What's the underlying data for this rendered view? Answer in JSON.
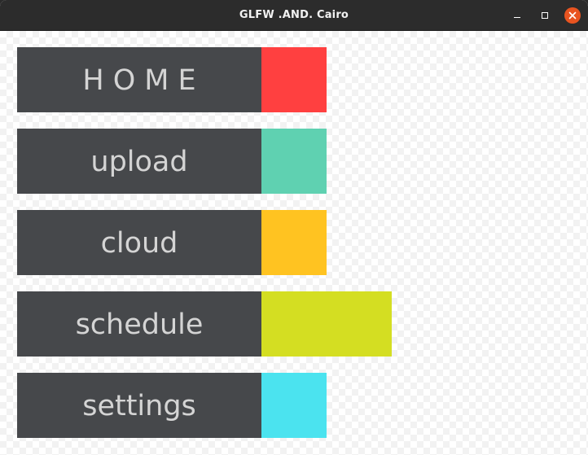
{
  "window": {
    "title": "GLFW .AND. Cairo",
    "buttons": [
      "minimize",
      "maximize",
      "close"
    ],
    "icons": {
      "minimize": "minimize-icon",
      "maximize": "maximize-icon",
      "close": "close-icon"
    },
    "close_color": "#e95420"
  },
  "menu": {
    "items": [
      {
        "label": "HOME",
        "color": "#ff4040",
        "highlighted": false
      },
      {
        "label": "upload",
        "color": "#5fd1b1",
        "highlighted": false
      },
      {
        "label": "cloud",
        "color": "#ffc321",
        "highlighted": false
      },
      {
        "label": "schedule",
        "color": "#d4de22",
        "highlighted": true
      },
      {
        "label": "settings",
        "color": "#4be3ef",
        "highlighted": false
      }
    ],
    "label_background": "#46484b",
    "label_color": "#d4d4d4"
  }
}
